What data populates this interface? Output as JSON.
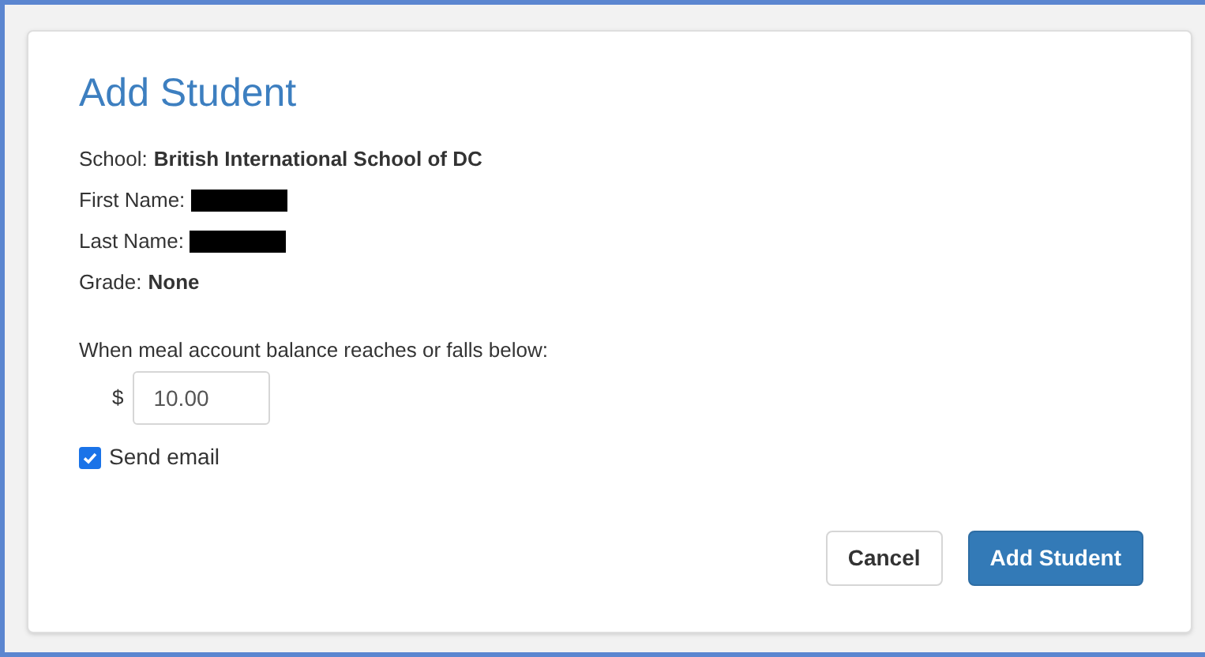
{
  "dialog": {
    "title": "Add Student",
    "fields": [
      {
        "kind": "text",
        "label": "School:",
        "value": "British International School of DC"
      },
      {
        "kind": "redacted",
        "label": "First Name:"
      },
      {
        "kind": "redacted",
        "label": "Last Name:"
      },
      {
        "kind": "text",
        "label": "Grade:",
        "value": "None"
      }
    ],
    "threshold": {
      "label": "When meal account balance reaches or falls below:",
      "currency": "$",
      "value": "10.00"
    },
    "send_email": {
      "label": "Send email",
      "checked": true
    },
    "buttons": [
      {
        "kind": "secondary",
        "label": "Cancel"
      },
      {
        "kind": "primary",
        "label": "Add Student"
      }
    ]
  }
}
